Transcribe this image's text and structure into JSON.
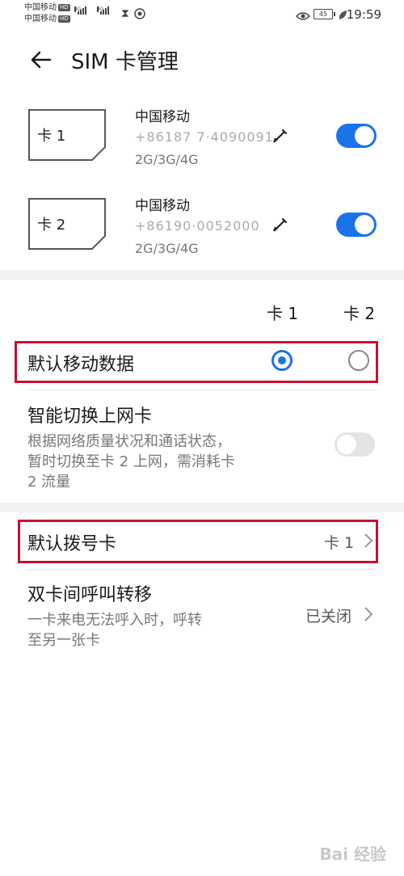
{
  "status_bar": {
    "carrier1": "中国移动",
    "carrier2": "中国移动",
    "hd_badge": "HD",
    "signal1_label": "4G",
    "signal2_label": "4G",
    "battery": "45",
    "time": "19:59"
  },
  "header": {
    "title": "SIM 卡管理"
  },
  "sims": [
    {
      "label": "卡 1",
      "carrier": "中国移动",
      "number": "+86187 7·4090091",
      "network": "2G/3G/4G",
      "enabled": true
    },
    {
      "label": "卡 2",
      "carrier": "中国移动",
      "number": "+86190·0052000",
      "network": "2G/3G/4G",
      "enabled": true
    }
  ],
  "columns": {
    "card1": "卡 1",
    "card2": "卡 2"
  },
  "default_data": {
    "title": "默认移动数据",
    "selected": "card1"
  },
  "smart_switch": {
    "title": "智能切换上网卡",
    "desc_line1": "根据网络质量状况和通话状态，",
    "desc_line2": "暂时切换至卡 2 上网，需消耗卡",
    "desc_line3": "2 流量",
    "enabled": false
  },
  "default_dial": {
    "title": "默认拨号卡",
    "value": "卡 1"
  },
  "call_forward": {
    "title": "双卡间呼叫转移",
    "desc_line1": "一卡来电无法呼入时，呼转",
    "desc_line2": "至另一张卡",
    "value": "已关闭"
  },
  "watermark": "Bai 经验",
  "colors": {
    "accent": "#1a73e8",
    "highlight": "#c8102e"
  },
  "icons": [
    "back-arrow-icon",
    "edit-icon",
    "chevron-right-icon",
    "eye-icon",
    "battery-icon"
  ]
}
